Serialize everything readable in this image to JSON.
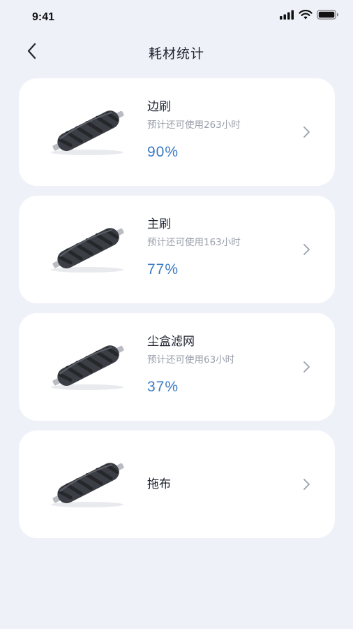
{
  "status_bar": {
    "time": "9:41"
  },
  "header": {
    "title": "耗材统计",
    "back_icon": "chevron-left-icon"
  },
  "items": [
    {
      "name": "边刷",
      "remaining": "预计还可使用263小时",
      "percent": "90%"
    },
    {
      "name": "主刷",
      "remaining": "预计还可使用163小时",
      "percent": "77%"
    },
    {
      "name": "尘盒滤网",
      "remaining": "预计还可使用63小时",
      "percent": "37%"
    },
    {
      "name": "拖布"
    }
  ],
  "colors": {
    "background": "#eef1f7",
    "card": "#ffffff",
    "accent": "#3a79c5",
    "secondary_text": "#9aa0aa"
  }
}
